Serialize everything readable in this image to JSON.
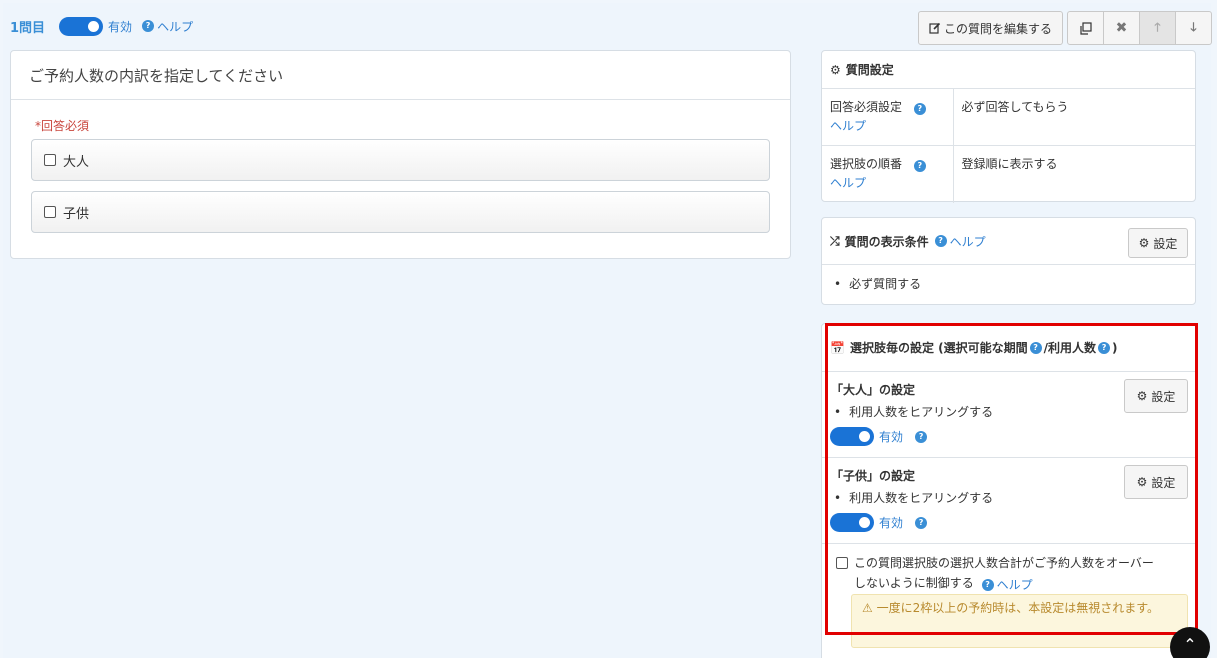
{
  "header": {
    "question_number": "1問目",
    "status_label": "有効",
    "help_label": "ヘルプ"
  },
  "toolbar": {
    "edit_label": "この質問を編集する",
    "edit_icon": "edit-icon",
    "copy_icon": "copy-icon",
    "delete_icon": "delete-icon",
    "up_icon": "arrow-up-icon",
    "down_icon": "arrow-down-icon"
  },
  "question": {
    "title": "ご予約人数の内訳を指定してください",
    "required_label": "*回答必須",
    "choices": [
      "大人",
      "子供"
    ]
  },
  "question_settings": {
    "title": "質問設定",
    "rows": [
      {
        "key": "回答必須設定",
        "help": "ヘルプ",
        "value": "必ず回答してもらう"
      },
      {
        "key": "選択肢の順番",
        "help": "ヘルプ",
        "value": "登録順に表示する"
      }
    ]
  },
  "display_condition": {
    "title": "質問の表示条件",
    "help_label": "ヘルプ",
    "button_label": "設定",
    "item": "必ず質問する"
  },
  "choice_settings": {
    "title_part1": "選択肢毎の設定 (選択可能な期間",
    "title_part2": "/利用人数",
    "title_part3": ")",
    "items": [
      {
        "title": "「大人」の設定",
        "bullet": "利用人数をヒアリングする",
        "status": "有効",
        "button_label": "設定"
      },
      {
        "title": "「子供」の設定",
        "bullet": "利用人数をヒアリングする",
        "status": "有効",
        "button_label": "設定"
      }
    ],
    "limit_line1": "この質問選択肢の選択人数合計がご予約人数をオーバー",
    "limit_line2": "しないように制御する",
    "limit_help": "ヘルプ",
    "warning": "一度に2枠以上の予約時は、本設定は無視されます。"
  },
  "colors": {
    "accent": "#1a73d6",
    "link": "#2f7fd0",
    "required": "#c9463d",
    "highlight_border": "#e10000",
    "warning_bg": "#fcf6dd"
  }
}
